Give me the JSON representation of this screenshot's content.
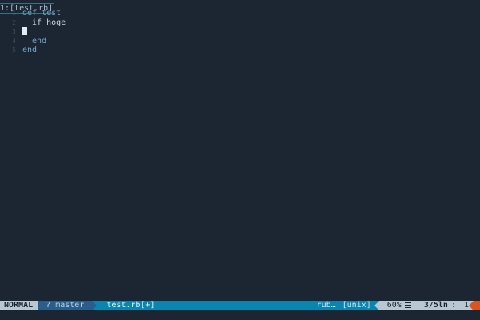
{
  "tabline": {
    "tab_label": "1:[test.rb]"
  },
  "editor": {
    "lines": [
      {
        "num": "1",
        "text": "def test"
      },
      {
        "num": "2",
        "text": "  if hoge"
      },
      {
        "num": "3",
        "text": ""
      },
      {
        "num": "4",
        "text": "  end"
      },
      {
        "num": "5",
        "text": "end"
      }
    ],
    "cursor_line": 3
  },
  "statusline": {
    "mode": "NORMAL",
    "branch_icon": "?",
    "branch": "master",
    "filename": "test.rb[+]",
    "filetype": "rub…",
    "fileformat": "[unix]",
    "percent": "60%",
    "menu_icon": "hamburger-icon",
    "lines": "3/5ln",
    "col_sep": ":",
    "column": "1"
  },
  "colors": {
    "background": "#1c2633",
    "statusline": "#0a85b0",
    "mode": "#b8c7d2",
    "warning": "#d9541e",
    "keyword": "#6fa6c5"
  }
}
